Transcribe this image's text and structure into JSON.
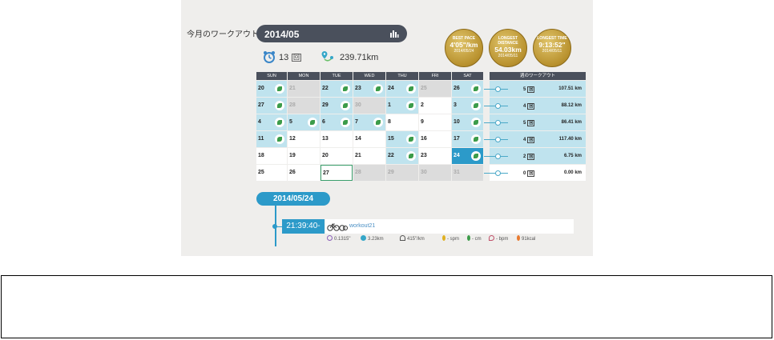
{
  "section_title": "今月のワークアウト",
  "month": "2014/05",
  "medals": [
    {
      "title": "BEST PACE",
      "value": "4'05\"/km",
      "date": "2014/05/24"
    },
    {
      "title": "LONGEST DISTANCE",
      "value": "54.03km",
      "date": "2014/05/11"
    },
    {
      "title": "LONGEST TIME",
      "value": "9:13:52\"",
      "date": "2014/05/11"
    }
  ],
  "stats": {
    "count": "13",
    "count_unit": "回",
    "distance": "239.71km"
  },
  "weekdays": [
    "SUN",
    "MON",
    "TUE",
    "WED",
    "THU",
    "FRI",
    "SAT"
  ],
  "calendar": [
    [
      {
        "d": "20",
        "s": "blue",
        "w": true
      },
      {
        "d": "21",
        "s": "grey",
        "w": false
      },
      {
        "d": "22",
        "s": "blue",
        "w": true
      },
      {
        "d": "23",
        "s": "blue",
        "w": true
      },
      {
        "d": "24",
        "s": "blue",
        "w": true
      },
      {
        "d": "25",
        "s": "grey",
        "w": false
      },
      {
        "d": "26",
        "s": "blue",
        "w": true
      }
    ],
    [
      {
        "d": "27",
        "s": "blue",
        "w": true
      },
      {
        "d": "28",
        "s": "grey",
        "w": false
      },
      {
        "d": "29",
        "s": "blue",
        "w": true
      },
      {
        "d": "30",
        "s": "grey",
        "w": false
      },
      {
        "d": "1",
        "s": "blue",
        "w": true
      },
      {
        "d": "2",
        "s": "white",
        "w": false
      },
      {
        "d": "3",
        "s": "blue",
        "w": true
      }
    ],
    [
      {
        "d": "4",
        "s": "blue",
        "w": true
      },
      {
        "d": "5",
        "s": "blue",
        "w": true
      },
      {
        "d": "6",
        "s": "blue",
        "w": true
      },
      {
        "d": "7",
        "s": "blue",
        "w": true
      },
      {
        "d": "8",
        "s": "white",
        "w": false
      },
      {
        "d": "9",
        "s": "white",
        "w": false
      },
      {
        "d": "10",
        "s": "blue",
        "w": true
      }
    ],
    [
      {
        "d": "11",
        "s": "blue",
        "w": true
      },
      {
        "d": "12",
        "s": "white",
        "w": false
      },
      {
        "d": "13",
        "s": "white",
        "w": false
      },
      {
        "d": "14",
        "s": "white",
        "w": false
      },
      {
        "d": "15",
        "s": "blue",
        "w": true
      },
      {
        "d": "16",
        "s": "white",
        "w": false
      },
      {
        "d": "17",
        "s": "blue",
        "w": true
      }
    ],
    [
      {
        "d": "18",
        "s": "white",
        "w": false
      },
      {
        "d": "19",
        "s": "white",
        "w": false
      },
      {
        "d": "20",
        "s": "white",
        "w": false
      },
      {
        "d": "21",
        "s": "white",
        "w": false
      },
      {
        "d": "22",
        "s": "blue",
        "w": true
      },
      {
        "d": "23",
        "s": "white",
        "w": false
      },
      {
        "d": "24",
        "s": "sel",
        "w": true
      }
    ],
    [
      {
        "d": "25",
        "s": "white",
        "w": false
      },
      {
        "d": "26",
        "s": "white",
        "w": false
      },
      {
        "d": "27",
        "s": "today",
        "w": false
      },
      {
        "d": "28",
        "s": "grey",
        "w": false
      },
      {
        "d": "29",
        "s": "grey",
        "w": false
      },
      {
        "d": "30",
        "s": "grey",
        "w": false
      },
      {
        "d": "31",
        "s": "grey",
        "w": false
      }
    ]
  ],
  "weekly_header": "週のワークアウト",
  "weekly": [
    {
      "count": "5",
      "unit": "回",
      "distance": "107.51 km"
    },
    {
      "count": "4",
      "unit": "回",
      "distance": "88.12 km"
    },
    {
      "count": "5",
      "unit": "回",
      "distance": "86.41 km"
    },
    {
      "count": "4",
      "unit": "回",
      "distance": "117.40 km"
    },
    {
      "count": "2",
      "unit": "回",
      "distance": "6.75 km"
    },
    {
      "count": "0",
      "unit": "回",
      "distance": "0.00 km"
    }
  ],
  "selected_date": "2014/05/24",
  "workout": {
    "time": "21:39:40-",
    "name": "workout21",
    "details": [
      "0.1315\"",
      "3.23km",
      "415\"/km",
      "- spm",
      "- cm",
      "- bpm",
      "91kcal"
    ]
  },
  "colors": {
    "accent": "#2c9ac9",
    "dark_bar": "#4a505c",
    "gold": "#b8912e",
    "workout_day": "#bfe3ee"
  }
}
